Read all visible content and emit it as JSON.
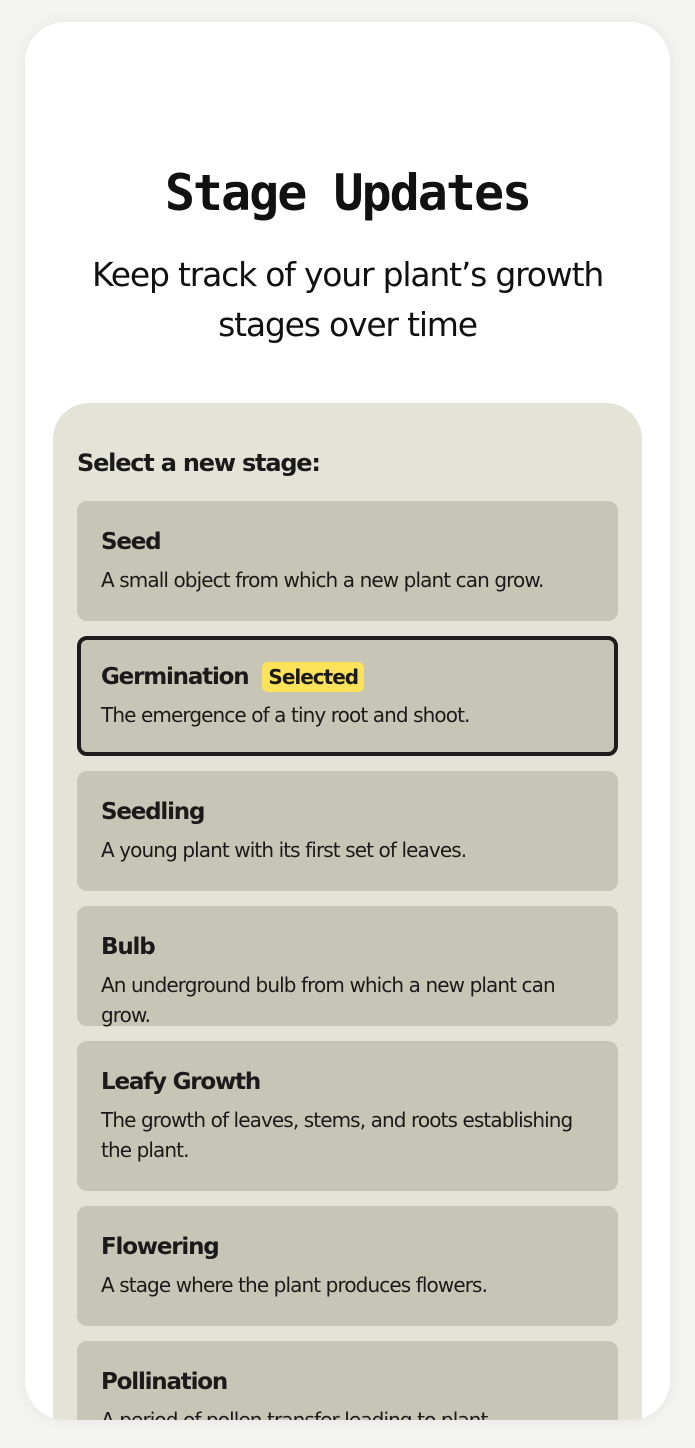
{
  "header": {
    "title": "Stage Updates",
    "subtitle": "Keep track of your plant’s growth stages over time"
  },
  "panel": {
    "heading": "Select a new stage:"
  },
  "stages": [
    {
      "name": "Seed",
      "description": "A small object from which a new plant can grow."
    },
    {
      "name": "Germination",
      "description": "The emergence of a tiny root and shoot.",
      "badge": "Selected"
    },
    {
      "name": "Seedling",
      "description": "A young plant with its first set of leaves."
    },
    {
      "name": "Bulb",
      "description": "An underground bulb from which a new plant can grow."
    },
    {
      "name": "Leafy Growth",
      "description": "The growth of leaves, stems, and roots establishing the plant."
    },
    {
      "name": "Flowering",
      "description": "A stage where the plant produces flowers."
    },
    {
      "name": "Pollination",
      "description": "A period of pollen transfer leading to plant fertilization."
    }
  ],
  "colors": {
    "panel_bg": "#e3e3d7",
    "card_bg": "#c7c6b6",
    "selected_border": "#1c1c1c",
    "badge_bg": "#fde25a"
  }
}
